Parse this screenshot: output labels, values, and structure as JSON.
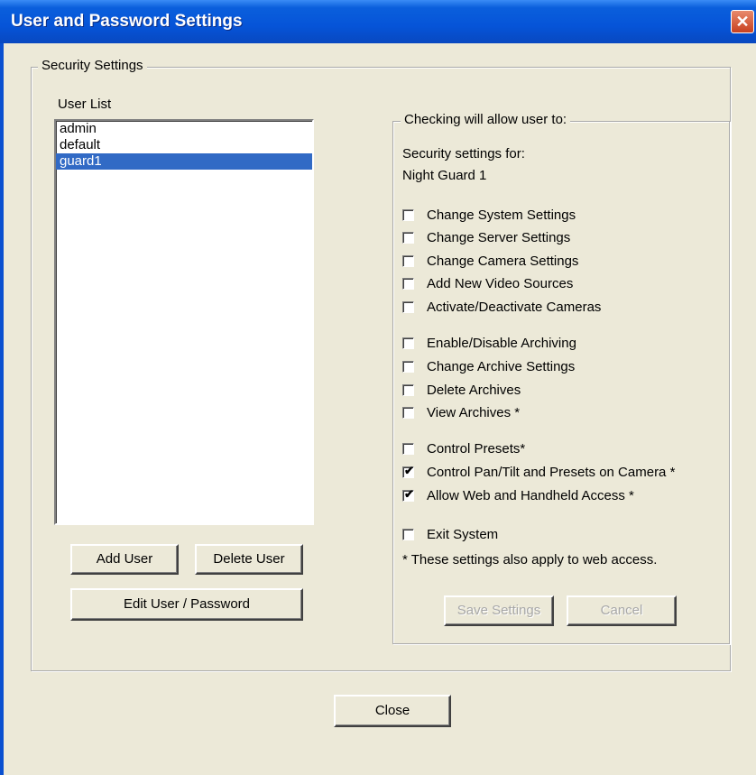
{
  "window": {
    "title": "User and Password Settings",
    "close_glyph": "✕"
  },
  "security": {
    "legend": "Security Settings",
    "user_list_label": "User List",
    "users": [
      {
        "name": "admin",
        "selected": false
      },
      {
        "name": "default",
        "selected": false
      },
      {
        "name": "guard1",
        "selected": true
      }
    ],
    "buttons": {
      "add": "Add User",
      "delete": "Delete User",
      "edit": "Edit User / Password"
    }
  },
  "permissions": {
    "legend": "Checking will allow user to:",
    "for_label": "Security settings for:",
    "user_display_name": "Night Guard 1",
    "items": [
      {
        "label": "Change System Settings",
        "checked": false
      },
      {
        "label": "Change Server Settings",
        "checked": false
      },
      {
        "label": "Change Camera Settings",
        "checked": false
      },
      {
        "label": "Add New Video Sources",
        "checked": false
      },
      {
        "label": "Activate/Deactivate Cameras",
        "checked": false
      },
      {
        "label": "Enable/Disable Archiving",
        "checked": false
      },
      {
        "label": "Change Archive Settings",
        "checked": false
      },
      {
        "label": "Delete Archives",
        "checked": false
      },
      {
        "label": "View Archives *",
        "checked": false
      },
      {
        "label": "Control Presets*",
        "checked": false
      },
      {
        "label": "Control Pan/Tilt and Presets on Camera *",
        "checked": true
      },
      {
        "label": "Allow Web and Handheld Access *",
        "checked": true
      },
      {
        "label": "Exit System",
        "checked": false
      }
    ],
    "note": "* These settings also apply to web access.",
    "save_label": "Save Settings",
    "cancel_label": "Cancel"
  },
  "footer": {
    "close_label": "Close"
  }
}
